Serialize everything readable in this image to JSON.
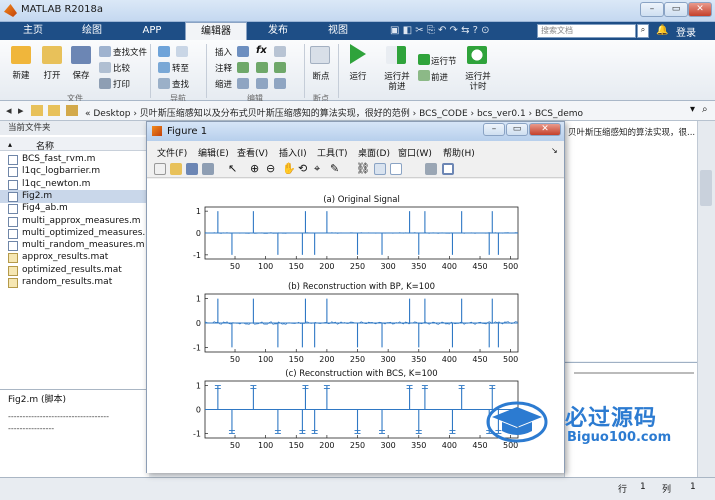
{
  "window": {
    "title": "MATLAB R2018a"
  },
  "tabs": [
    "主页",
    "绘图",
    "APP",
    "编辑器",
    "发布",
    "视图"
  ],
  "active_tab": "编辑器",
  "search": {
    "placeholder": "搜索文档"
  },
  "ribbon": {
    "file_group": {
      "label": "文件",
      "new": "新建",
      "open": "打开",
      "save": "保存",
      "find_files": "查找文件",
      "compare": "比较",
      "print": "打印"
    },
    "nav_group": {
      "label": "导航",
      "goto": "转至",
      "find": "查找"
    },
    "edit_group": {
      "label": "编辑",
      "insert": "插入",
      "comment": "注释",
      "indent": "缩进"
    },
    "breakpoint_group": {
      "label": "断点",
      "breakpoints": "断点"
    },
    "run_group": {
      "run": "运行",
      "run_advance_line1": "运行并",
      "run_advance_line2": "前进",
      "run_section": "运行节",
      "advance": "前进",
      "run_time_line1": "运行并",
      "run_time_line2": "计时"
    }
  },
  "address": {
    "path": "« Desktop › 贝叶斯压缩感知以及分布式贝叶斯压缩感知的算法实现，很好的范例 › BCS_CODE › bcs_ver0.1 › BCS_demo"
  },
  "current_folder": {
    "title": "当前文件夹",
    "column": "名称"
  },
  "files": [
    "BCS_fast_rvm.m",
    "l1qc_logbarrier.m",
    "l1qc_newton.m",
    "Fig2.m",
    "Fig4_ab.m",
    "multi_approx_measures.m",
    "multi_optimized_measures.m",
    "multi_random_measures.m",
    "approx_results.mat",
    "optimized_results.mat",
    "random_results.mat"
  ],
  "selected_file": "Fig2.m",
  "details": {
    "title": "Fig2.m  (脚本)",
    "line1": "-----------------------------------",
    "line2": "----------------"
  },
  "editor_text": "贝叶斯压缩感知的算法实现，很...",
  "status": {
    "row_label": "行",
    "row_value": "1",
    "col_label": "列",
    "col_value": "1"
  },
  "figure": {
    "title": "Figure 1",
    "menus": [
      "文件(F)",
      "编辑(E)",
      "查看(V)",
      "插入(I)",
      "工具(T)",
      "桌面(D)",
      "窗口(W)",
      "帮助(H)"
    ]
  },
  "chart_data": [
    {
      "type": "line",
      "title": "(a) Original Signal",
      "xlim": [
        1,
        512
      ],
      "ylim": [
        -1,
        1
      ],
      "yticks": [
        -1,
        0,
        1
      ],
      "xticks": [
        50,
        100,
        150,
        200,
        250,
        300,
        350,
        400,
        450,
        500
      ],
      "spikes_x": [
        22,
        45,
        80,
        120,
        160,
        165,
        180,
        200,
        250,
        290,
        335,
        350,
        360,
        405,
        420,
        465,
        470,
        480
      ],
      "spikes_y": [
        1,
        -1,
        1,
        -1,
        -1,
        1,
        -1,
        1,
        -1,
        -1,
        1,
        -1,
        1,
        -1,
        1,
        -1,
        1,
        -1
      ]
    },
    {
      "type": "line",
      "title": "(b) Reconstruction with BP, K=100",
      "xlim": [
        1,
        512
      ],
      "ylim": [
        -1,
        1
      ],
      "yticks": [
        -1,
        0,
        1
      ],
      "xticks": [
        50,
        100,
        150,
        200,
        250,
        300,
        350,
        400,
        450,
        500
      ],
      "spikes_x": [
        22,
        45,
        80,
        120,
        160,
        165,
        180,
        200,
        250,
        290,
        335,
        350,
        360,
        405,
        420,
        465,
        470,
        480
      ],
      "spikes_y": [
        1,
        -1,
        1,
        -1,
        -1,
        1,
        -1,
        1,
        -1,
        -1,
        1,
        -1,
        1,
        -1,
        1,
        -1,
        1,
        -1
      ]
    },
    {
      "type": "line",
      "title": "(c) Reconstruction with BCS, K=100",
      "xlim": [
        1,
        512
      ],
      "ylim": [
        -1,
        1
      ],
      "yticks": [
        -1,
        0,
        1
      ],
      "xticks": [
        50,
        100,
        150,
        200,
        250,
        300,
        350,
        400,
        450,
        500
      ],
      "spikes_x": [
        22,
        45,
        80,
        120,
        160,
        165,
        180,
        200,
        250,
        290,
        335,
        350,
        360,
        405,
        420,
        465,
        470,
        480
      ],
      "spikes_y": [
        1,
        -1,
        1,
        -1,
        -1,
        1,
        -1,
        1,
        -1,
        -1,
        1,
        -1,
        1,
        -1,
        1,
        -1,
        1,
        -1
      ]
    }
  ],
  "watermark": {
    "text": "必过源码",
    "url": "Biguo100.com"
  },
  "colors": {
    "tab_bar": "#1e4e86",
    "plot_line": "#2f78c4",
    "watermark": "#2c7bd1"
  }
}
